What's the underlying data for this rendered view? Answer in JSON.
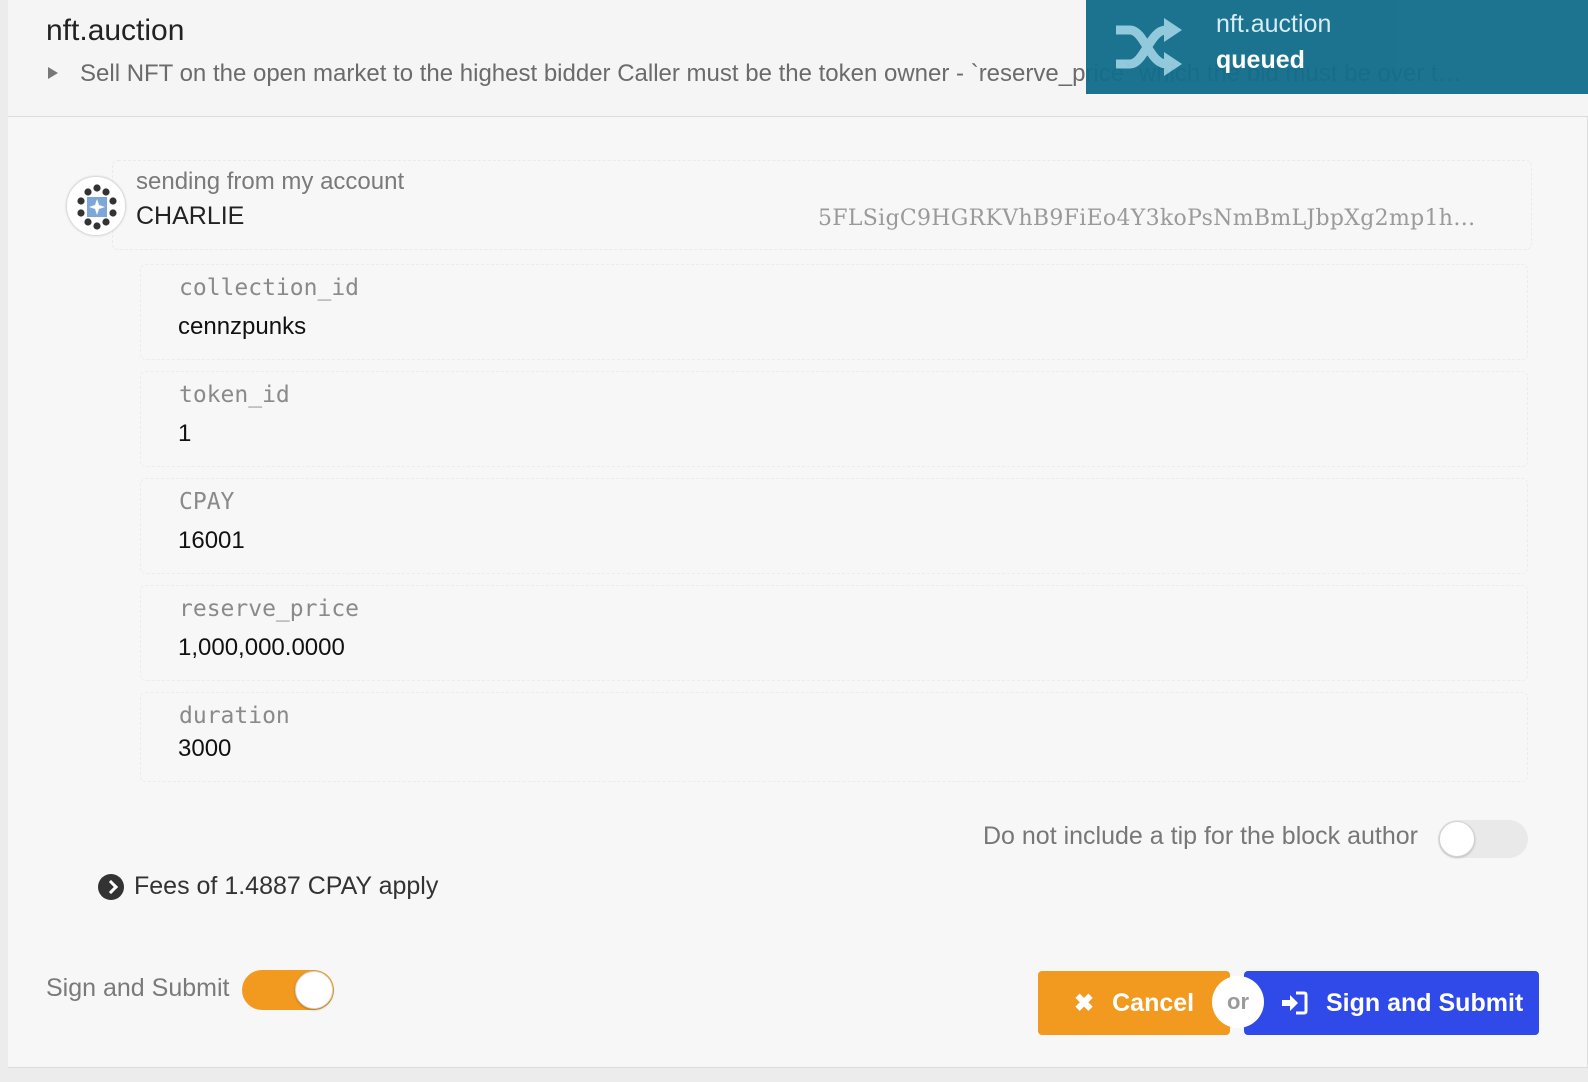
{
  "header": {
    "title": "nft.auction",
    "description": "Sell NFT on the open market to the highest bidder Caller must be the token owner - `reserve_price` which the bid must be over t…"
  },
  "status": {
    "title": "nft.auction",
    "state": "queued",
    "icon": "shuffle-icon",
    "color": "#136e8c"
  },
  "account": {
    "label": "sending from my account",
    "name": "CHARLIE",
    "address": "5FLSigC9HGRKVhB9FiEo4Y3koPsNmBmLJbpXg2mp1h…"
  },
  "params": [
    {
      "label": "collection_id",
      "value": "cennzpunks"
    },
    {
      "label": "token_id",
      "value": "1"
    },
    {
      "label": "CPAY",
      "value": "16001"
    },
    {
      "label": "reserve_price",
      "value": "1,000,000.0000"
    },
    {
      "label": "duration",
      "value": "3000"
    }
  ],
  "tip": {
    "label": "Do not include a tip for the block author",
    "enabled": false
  },
  "fees": {
    "text": "Fees of 1.4887 CPAY apply"
  },
  "sign_toggle": {
    "label": "Sign and Submit",
    "enabled": true,
    "color": "#f19a1f"
  },
  "actions": {
    "cancel_label": "Cancel",
    "or_label": "or",
    "submit_label": "Sign and Submit",
    "cancel_color": "#f19a1f",
    "submit_color": "#2f4ae8"
  }
}
